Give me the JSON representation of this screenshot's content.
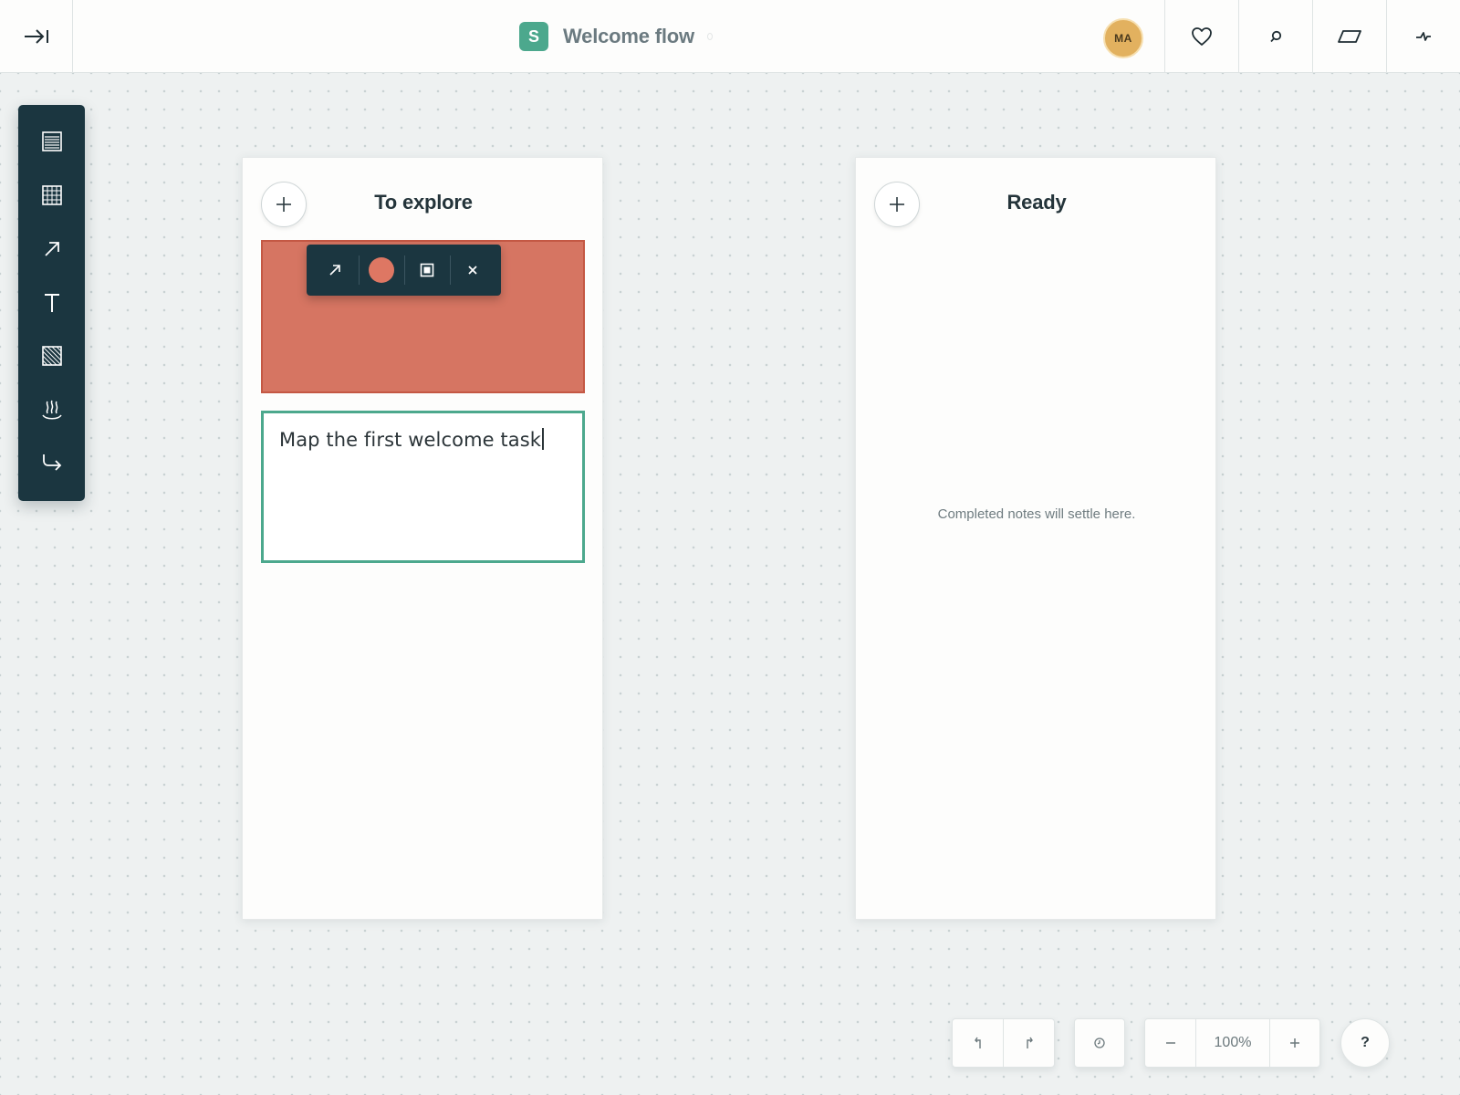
{
  "header": {
    "board_badge": "S",
    "board_title": "Welcome flow",
    "avatar_initials": "MA",
    "accent_color": "#4ca88d"
  },
  "toolrail": {
    "tools": [
      "sticky-note-icon",
      "grid-icon",
      "arrow-icon",
      "text-icon",
      "pattern-icon",
      "steam-icon",
      "redirect-icon"
    ]
  },
  "columns": [
    {
      "title": "To explore",
      "notes": [
        {
          "color": "#d67562",
          "text": ""
        },
        {
          "color": "#ffffff",
          "text": "Map the first welcome task",
          "editing": true
        }
      ]
    },
    {
      "title": "Ready",
      "empty_hint": "Completed notes will settle here."
    }
  ],
  "note_toolbar": {
    "swatch_color": "#de7763",
    "actions": [
      "arrow-icon",
      "color-swatch",
      "frame-icon",
      "close-icon"
    ]
  },
  "bottom_controls": {
    "zoom_level": "100%",
    "help_label": "?"
  }
}
